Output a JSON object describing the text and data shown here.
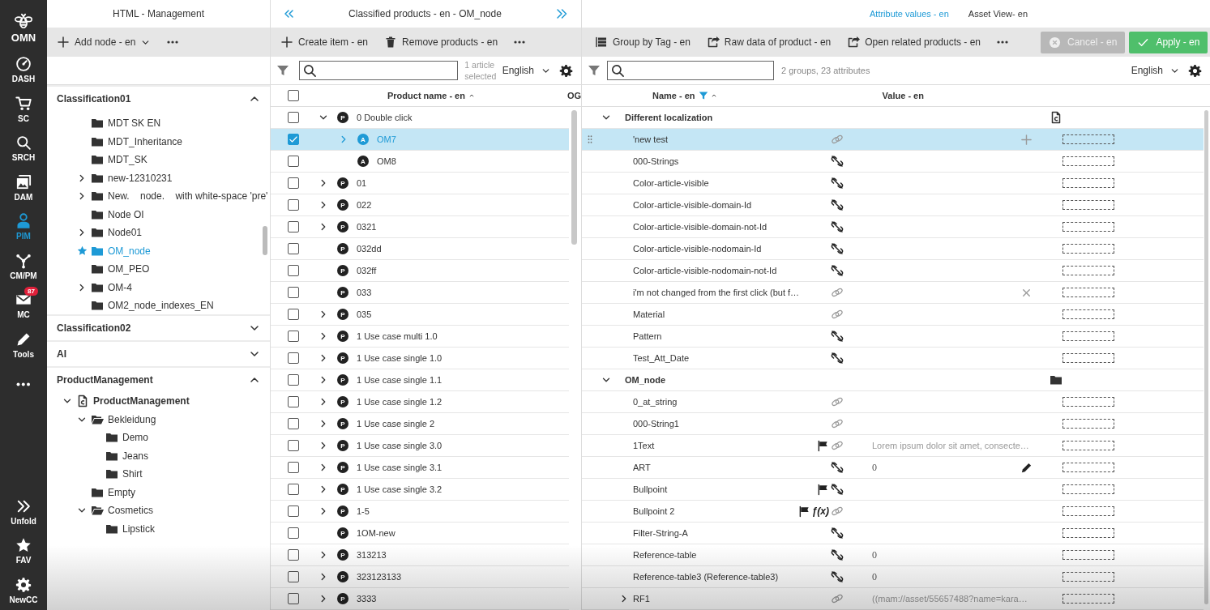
{
  "nav": {
    "logo": "OMN",
    "items": [
      {
        "label": "DASH",
        "kind": "gauge",
        "selected": false
      },
      {
        "label": "SC",
        "kind": "cart",
        "selected": false
      },
      {
        "label": "SRCH",
        "kind": "search",
        "selected": false
      },
      {
        "label": "DAM",
        "kind": "images",
        "selected": false
      },
      {
        "label": "PIM",
        "kind": "person",
        "selected": true
      },
      {
        "label": "CM/PM",
        "kind": "network",
        "selected": false
      },
      {
        "label": "MC",
        "kind": "mail",
        "selected": false,
        "badge": "87"
      },
      {
        "label": "Tools",
        "kind": "pencil",
        "selected": false
      },
      {
        "kind": "more",
        "selected": false
      }
    ],
    "bottom": [
      {
        "label": "Unfold",
        "kind": "unfold"
      },
      {
        "label": "FAV",
        "kind": "star"
      },
      {
        "label": "NewCC",
        "kind": "settings"
      }
    ]
  },
  "tree_panel": {
    "title": "HTML - Management",
    "toolbar": [
      {
        "kind": "add-menu",
        "label": "Add node - en"
      },
      {
        "kind": "more"
      }
    ],
    "sections": [
      {
        "title": "Classification01",
        "expanded": true,
        "items": [
          {
            "label": "MDT SK EN",
            "kind": "folder",
            "selected": false
          },
          {
            "label": "MDT_Inheritance",
            "kind": "folder",
            "selected": false
          },
          {
            "label": "MDT_SK",
            "kind": "folder",
            "selected": false
          },
          {
            "label": "new-12310231",
            "kind": "folder",
            "selected": false,
            "expanded": false
          },
          {
            "label": "New.    node.    with white-space 'pre'",
            "kind": "folder",
            "selected": false,
            "expanded": false
          },
          {
            "label": "Node OI",
            "kind": "folder",
            "selected": false
          },
          {
            "label": "Node01",
            "kind": "folder",
            "selected": false,
            "expanded": false
          },
          {
            "label": "OM_node",
            "kind": "folder",
            "selected": true,
            "favorite": true
          },
          {
            "label": "OM_PEO",
            "kind": "folder",
            "selected": false
          },
          {
            "label": "OM-4",
            "kind": "folder",
            "selected": false,
            "expanded": false
          },
          {
            "label": "OM2_node_indexes_EN",
            "kind": "folder",
            "selected": false
          }
        ]
      },
      {
        "title": "Classification02",
        "expanded": false
      },
      {
        "title": "AI",
        "expanded": false
      },
      {
        "title": "ProductManagement",
        "expanded": true,
        "items": [
          {
            "label": "ProductManagement",
            "kind": "root",
            "selected": false,
            "expanded": true,
            "children": [
              {
                "label": "Bekleidung",
                "kind": "folder",
                "selected": false,
                "expanded": true,
                "children": [
                  {
                    "label": "Demo",
                    "kind": "folder",
                    "selected": false
                  },
                  {
                    "label": "Jeans",
                    "kind": "folder",
                    "selected": false
                  },
                  {
                    "label": "Shirt",
                    "kind": "folder",
                    "selected": false
                  }
                ]
              },
              {
                "label": "Empty",
                "kind": "folder",
                "selected": false
              },
              {
                "label": "Cosmetics",
                "kind": "folder",
                "selected": false,
                "expanded": true,
                "children": [
                  {
                    "label": "Lipstick",
                    "kind": "folder",
                    "selected": false
                  }
                ]
              }
            ]
          }
        ]
      }
    ]
  },
  "products": {
    "title": "Classified products - en - OM_node",
    "toolbar": [
      {
        "kind": "add",
        "label": "Create item - en"
      },
      {
        "kind": "delete",
        "label": "Remove products - en"
      },
      {
        "kind": "more"
      }
    ],
    "selection_info": "1 article selected",
    "language": "English",
    "all_checked": false,
    "columns": [
      "Product name - en",
      "OG"
    ],
    "rows": [
      {
        "name": "0 Double click",
        "badge": "P",
        "checked": false,
        "selected": false,
        "expanded": true,
        "children": [
          {
            "name": "OM7",
            "badge": "A",
            "checked": true,
            "selected": true,
            "expanded": false
          },
          {
            "name": "OM8",
            "badge": "A",
            "checked": false,
            "selected": false
          }
        ]
      },
      {
        "name": "01",
        "badge": "P",
        "checked": false,
        "selected": false,
        "expanded": false
      },
      {
        "name": "022",
        "badge": "P",
        "checked": false,
        "selected": false,
        "expanded": false
      },
      {
        "name": "0321",
        "badge": "P",
        "checked": false,
        "selected": false,
        "expanded": false
      },
      {
        "name": "032dd",
        "badge": "P",
        "checked": false,
        "selected": false
      },
      {
        "name": "032ff",
        "badge": "P",
        "checked": false,
        "selected": false
      },
      {
        "name": "033",
        "badge": "P",
        "checked": false,
        "selected": false
      },
      {
        "name": "035",
        "badge": "P",
        "checked": false,
        "selected": false,
        "expanded": false
      },
      {
        "name": "1 Use case multi 1.0",
        "badge": "P",
        "checked": false,
        "selected": false,
        "expanded": false
      },
      {
        "name": "1 Use case single 1.0",
        "badge": "P",
        "checked": false,
        "selected": false,
        "expanded": false
      },
      {
        "name": "1 Use case single 1.1",
        "badge": "P",
        "checked": false,
        "selected": false,
        "expanded": false
      },
      {
        "name": "1 Use case single 1.2",
        "badge": "P",
        "checked": false,
        "selected": false,
        "expanded": false
      },
      {
        "name": "1 Use case single 2",
        "badge": "P",
        "checked": false,
        "selected": false,
        "expanded": false
      },
      {
        "name": "1 Use case single 3.0",
        "badge": "P",
        "checked": false,
        "selected": false,
        "expanded": false
      },
      {
        "name": "1 Use case single 3.1",
        "badge": "P",
        "checked": false,
        "selected": false,
        "expanded": false
      },
      {
        "name": "1 Use case single 3.2",
        "badge": "P",
        "checked": false,
        "selected": false,
        "expanded": false
      },
      {
        "name": "1-5",
        "badge": "P",
        "checked": false,
        "selected": false,
        "expanded": false
      },
      {
        "name": "1OM-new",
        "badge": "P",
        "checked": false,
        "selected": false
      },
      {
        "name": "313213",
        "badge": "P",
        "checked": false,
        "selected": false,
        "expanded": false
      },
      {
        "name": "323123133",
        "badge": "P",
        "checked": false,
        "selected": false,
        "expanded": false
      },
      {
        "name": "3333",
        "badge": "P",
        "checked": false,
        "selected": false,
        "expanded": false
      }
    ]
  },
  "attributes": {
    "tabs": [
      {
        "label": "Attribute values - en",
        "selected": true
      },
      {
        "label": "Asset View- en",
        "selected": false
      }
    ],
    "toolbar": [
      {
        "kind": "group",
        "label": "Group by Tag - en"
      },
      {
        "kind": "export",
        "label": "Raw data of product - en"
      },
      {
        "kind": "export",
        "label": "Open related products - en"
      },
      {
        "kind": "more"
      }
    ],
    "cancel": {
      "label": "Cancel - en",
      "disabled": true
    },
    "apply": {
      "label": "Apply - en",
      "disabled": false
    },
    "summary": "2 groups, 23 attributes",
    "language": "English",
    "columns": [
      "Name - en",
      "Value - en"
    ],
    "groups": [
      {
        "name": "Different localization",
        "kind": "doc",
        "expanded": true,
        "rows": [
          {
            "name": "'new test",
            "linked": true,
            "selected": true,
            "add": true
          },
          {
            "name": "000-Strings",
            "linked": false,
            "selected": false
          },
          {
            "name": "Color-article-visible",
            "linked": false,
            "selected": false
          },
          {
            "name": "Color-article-visible-domain-Id",
            "linked": false,
            "selected": false
          },
          {
            "name": "Color-article-visible-domain-not-Id",
            "linked": false,
            "selected": false
          },
          {
            "name": "Color-article-visible-nodomain-Id",
            "linked": false,
            "selected": false
          },
          {
            "name": "Color-article-visible-nodomain-not-Id",
            "linked": false,
            "selected": false
          },
          {
            "name": "i'm not changed from the first click (but f…",
            "linked": true,
            "selected": false,
            "clear": true
          },
          {
            "name": "Material",
            "linked": true,
            "selected": false
          },
          {
            "name": "Pattern",
            "linked": false,
            "selected": false
          },
          {
            "name": "Test_Att_Date",
            "linked": false,
            "selected": false
          }
        ]
      },
      {
        "name": "OM_node",
        "kind": "folder",
        "expanded": true,
        "rows": [
          {
            "name": "0_at_string",
            "linked": true,
            "selected": false
          },
          {
            "name": "000-String1",
            "linked": true,
            "selected": false
          },
          {
            "name": "1Text",
            "linked": true,
            "selected": false,
            "flag": true,
            "value": "Lorem ipsum dolor sit amet, consecte…"
          },
          {
            "name": "ART",
            "linked": false,
            "selected": false,
            "value": "0",
            "edit": true
          },
          {
            "name": "Bullpoint",
            "linked": false,
            "selected": false,
            "flag": true
          },
          {
            "name": "Bullpoint 2",
            "linked": true,
            "selected": false,
            "flag": true,
            "formula": "ƒ(x)"
          },
          {
            "name": "Filter-String-A",
            "linked": false,
            "selected": false
          },
          {
            "name": "Reference-table",
            "linked": false,
            "selected": false,
            "value": "0"
          },
          {
            "name": "Reference-table3 (Reference-table3)",
            "linked": false,
            "selected": false,
            "value": "0"
          },
          {
            "name": "RF1",
            "linked": true,
            "selected": false,
            "expanded": false,
            "value": "((mam://asset/55657488?name=kara…"
          }
        ]
      }
    ]
  }
}
